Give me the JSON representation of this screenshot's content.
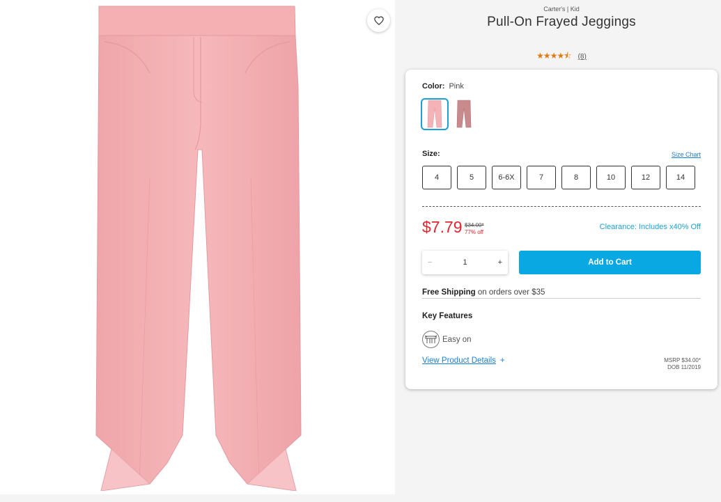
{
  "product": {
    "brand": "Carter's | Kid",
    "title": "Pull-On Frayed Jeggings",
    "rating": 4.5,
    "review_count": "(8)",
    "image_alt": "Pink frayed jeggings"
  },
  "color": {
    "label": "Color:",
    "value": "Pink",
    "swatches": [
      {
        "name": "Pink",
        "selected": true,
        "hex": "#f5b3b8"
      },
      {
        "name": "Mauve",
        "selected": false,
        "hex": "#c98a8d"
      }
    ]
  },
  "size": {
    "label": "Size:",
    "chart_link": "Size Chart",
    "options": [
      "4",
      "5",
      "6-6X",
      "7",
      "8",
      "10",
      "12",
      "14"
    ]
  },
  "price": {
    "current": "$7.79",
    "original": "$34.00*",
    "percent_off": "77% off",
    "clearance": "Clearance: Includes x40% Off"
  },
  "cart": {
    "minus": "−",
    "quantity": "1",
    "plus": "+",
    "add_label": "Add to Cart"
  },
  "shipping": {
    "bold": "Free Shipping",
    "rest": " on orders over $35"
  },
  "features": {
    "title": "Key Features",
    "items": [
      {
        "label": "Easy on",
        "icon": "easy-on-icon"
      }
    ]
  },
  "details": {
    "link": "View Product Details",
    "plus": "+",
    "msrp": "MSRP $34.00*",
    "dob": "DOB 11/2019"
  },
  "colors": {
    "accent": "#0aa8e3",
    "sale": "#e0262e",
    "star": "#e07b12",
    "link": "#1a7fd0"
  }
}
